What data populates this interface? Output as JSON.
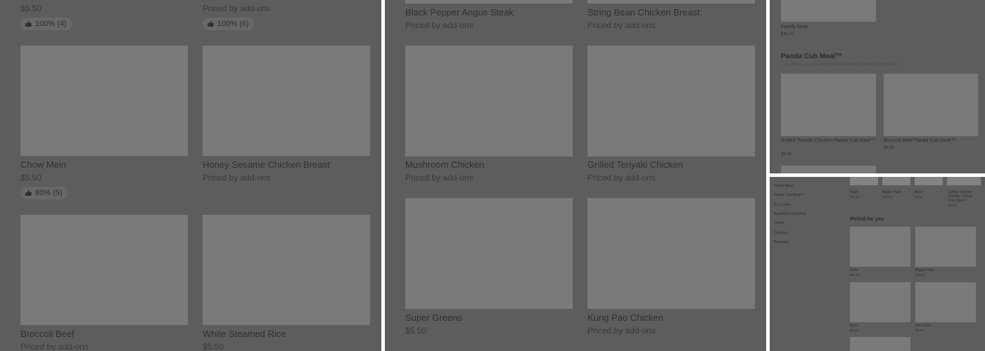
{
  "panel1": {
    "top": [
      {
        "price": "$5.50",
        "rating": "100% (4)"
      },
      {
        "price": "Priced by add-ons",
        "rating": "100% (6)"
      }
    ],
    "items": [
      {
        "name": "Chow Mein",
        "price": "$5.50",
        "rating": "80% (5)"
      },
      {
        "name": "Honey Sesame Chicken Breast",
        "price": "Priced by add-ons"
      },
      {
        "name": "Broccoli Beef",
        "price": "Priced by add-ons"
      },
      {
        "name": "White Steamed Rice",
        "price": "$5.50"
      }
    ]
  },
  "panel2": {
    "items": [
      {
        "name": "Black Pepper Angus Steak",
        "price": "Priced by add-ons"
      },
      {
        "name": "String Bean Chicken Breast",
        "price": "Priced by add-ons"
      },
      {
        "name": "Mushroom Chicken",
        "price": "Priced by add-ons"
      },
      {
        "name": "Grilled Teriyaki Chicken",
        "price": "Priced by add-ons"
      },
      {
        "name": "Super Greens",
        "price": "$5.50"
      },
      {
        "name": "Kung Pao Chicken",
        "price": "Priced by add-ons"
      }
    ]
  },
  "panel3": {
    "family": {
      "name": "Family Meal",
      "price": "$43.75"
    },
    "section_title": "Panda Cub Meal™",
    "section_sub": "1 Jr. Side, 1 Jr. Entree, Fruit Side & Bottled Water or Kids Juice",
    "items": [
      {
        "name": "Grilled Teriyaki Chicken Panda Cub Meal™",
        "price": "$6.00"
      },
      {
        "name": "Broccoli Beef Panda Cub Meal™",
        "price": "$6.00"
      }
    ]
  },
  "panel4": {
    "nav": [
      "Family Meal",
      "Panda Cub Meal™",
      "A La Carte",
      "Appetizers and More",
      "Drinks",
      "Catering",
      "Requests"
    ],
    "top_items": [
      {
        "name": "Plate",
        "price": "$11.00"
      },
      {
        "name": "Bigger Plate",
        "price": "$13.00"
      },
      {
        "name": "Bowl",
        "price": "$9.50"
      },
      {
        "name": "Grilled Teriyaki Chicken Panda Cub Meal™",
        "price": "$6.00"
      }
    ],
    "picked_title": "Picked for you",
    "picked": [
      {
        "name": "Plate",
        "price": "$11.00"
      },
      {
        "name": "Bigger Plate",
        "price": "$13.00"
      },
      {
        "name": "Bowl",
        "price": "$9.50"
      },
      {
        "name": "Diet Coke",
        "price": "$2.95"
      }
    ]
  }
}
